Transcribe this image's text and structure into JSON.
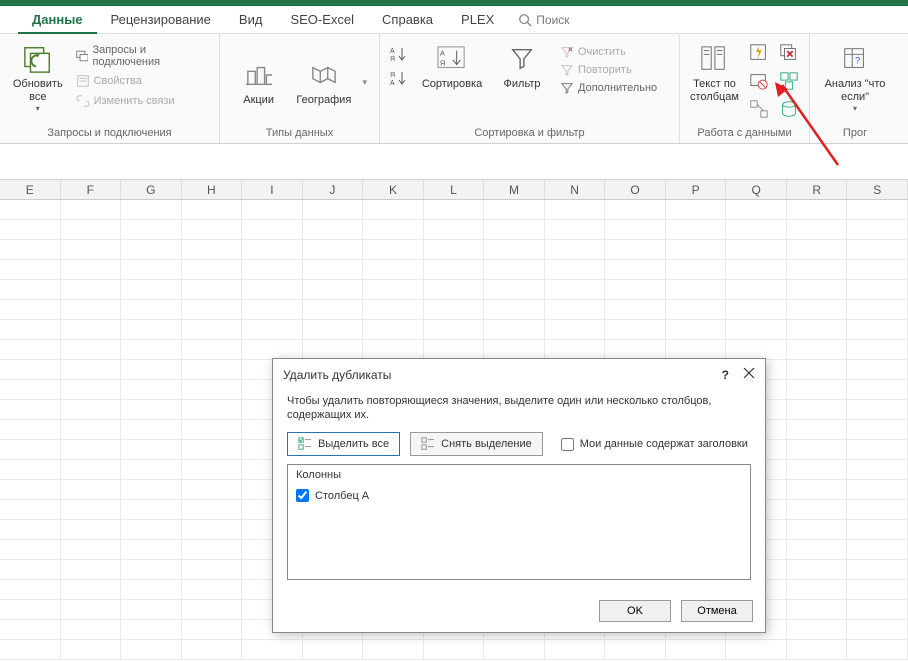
{
  "tabs": {
    "data": "Данные",
    "review": "Рецензирование",
    "view": "Вид",
    "seo": "SEO-Excel",
    "help": "Справка",
    "plex": "PLEX",
    "search": "Поиск"
  },
  "ribbon": {
    "refresh": {
      "label": "Обновить все",
      "menu": "▾"
    },
    "queries": {
      "label1": "Запросы и подключения",
      "label2": "Свойства",
      "label3": "Изменить связи"
    },
    "group_queries": "Запросы и подключения",
    "stocks": {
      "label": "Акции"
    },
    "geo": {
      "label": "География"
    },
    "group_types": "Типы данных",
    "sort": {
      "label": "Сортировка"
    },
    "filter": {
      "label": "Фильтр"
    },
    "filter_side": {
      "clear": "Очистить",
      "reapply": "Повторить",
      "advanced": "Дополнительно"
    },
    "group_sort": "Сортировка и фильтр",
    "text_cols": {
      "label": "Текст по столбцам"
    },
    "group_tools": "Работа с данными",
    "whatif": {
      "label": "Анализ \"что если\"",
      "menu": "▾"
    },
    "group_forecast": "Прог"
  },
  "columns": [
    "E",
    "F",
    "G",
    "H",
    "I",
    "J",
    "K",
    "L",
    "M",
    "N",
    "O",
    "P",
    "Q",
    "R",
    "S"
  ],
  "dialog": {
    "title": "Удалить дубликаты",
    "desc": "Чтобы удалить повторяющиеся значения, выделите один или несколько столбцов, содержащих их.",
    "select_all": "Выделить все",
    "deselect_all": "Снять выделение",
    "headers_chk": "Мои данные содержат заголовки",
    "list_head": "Колонны",
    "item_a": "Столбец A",
    "ok": "OK",
    "cancel": "Отмена",
    "help": "?",
    "close": "✕"
  }
}
